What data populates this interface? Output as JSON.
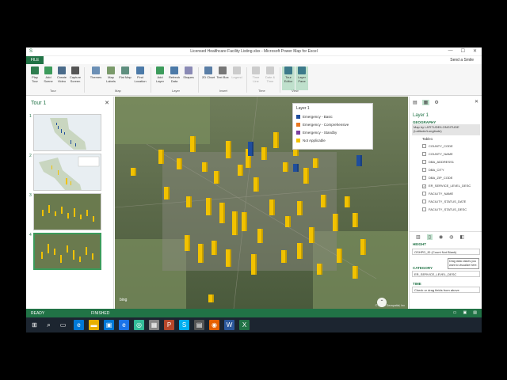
{
  "window": {
    "title": "Licensed Healthcare Facility Listing.xlsx - Microsoft Power Map for Excel",
    "file_tab": "FILE",
    "send_smile": "Send a Smile",
    "quick_access": "S",
    "min": "—",
    "max": "☐",
    "close": "✕"
  },
  "ribbon": {
    "buttons": {
      "play_tour": "Play Tour",
      "add_scene": "Add Scene",
      "create_video": "Create Video",
      "capture_screen": "Capture Screen",
      "themes": "Themes",
      "map_labels": "Map Labels",
      "flat_map": "Flat Map",
      "find_location": "Find Location",
      "add_layer": "Add Layer",
      "refresh_data": "Refresh Data",
      "shapes": "Shapes",
      "chart_2d": "2D Chart",
      "text_box": "Text Box",
      "legend": "Legend",
      "time_line": "Time Line",
      "date_time": "Date & Time",
      "tour_editor": "Tour Editor",
      "layer_pane": "Layer Pane"
    },
    "groups": {
      "tour": "Tour",
      "map": "Map",
      "layer": "Layer",
      "insert": "Insert",
      "time": "Time",
      "view": "View"
    }
  },
  "tour_pane": {
    "title": "Tour 1",
    "close": "✕",
    "scenes": [
      "1",
      "2",
      "3",
      "4"
    ]
  },
  "legend": {
    "title": "Layer 1",
    "items": [
      {
        "label": "Emergency - Basic",
        "color": "#1f4e9c"
      },
      {
        "label": "Emergency - Comprehensive",
        "color": "#e87722"
      },
      {
        "label": "Emergency - Standby",
        "color": "#7b3f9e"
      },
      {
        "label": "Not Applicable",
        "color": "#f2c200"
      }
    ]
  },
  "map": {
    "bing": "bing",
    "copyright": "© Harris Geospatial, Inc"
  },
  "field_pane": {
    "layer_name": "Layer 1",
    "close": "✕",
    "geography_label": "GEOGRAPHY",
    "geography_value": "Map by LATITUDE/LONGITUDE (Latitude/Longitude)",
    "table_name": "Table1",
    "fields": [
      {
        "name": "COUNTY_CODE",
        "checked": false
      },
      {
        "name": "COUNTY_NAME",
        "checked": false
      },
      {
        "name": "DBA_ADDRESS1",
        "checked": false
      },
      {
        "name": "DBA_CITY",
        "checked": false
      },
      {
        "name": "DBA_ZIP_CODE",
        "checked": false
      },
      {
        "name": "ER_SERVICE_LEVEL_DESC",
        "checked": true
      },
      {
        "name": "FACILITY_NAME",
        "checked": false
      },
      {
        "name": "FACILITY_STATUS_DATE",
        "checked": false
      },
      {
        "name": "FACILITY_STATUS_DESC",
        "checked": false
      }
    ],
    "height_label": "HEIGHT",
    "height_value": "OSHPD_ID (Count Not Blank)",
    "category_label": "CATEGORY",
    "category_value": "ER_SERVICE_LEVEL_DESC",
    "time_label": "TIME",
    "time_value": "Check or drag fields from above",
    "tooltip": "Drag data values you want to visualize here."
  },
  "status": {
    "ready": "READY",
    "finished": "FINISHED"
  },
  "colors": {
    "accent": "#217346",
    "bar_yellow": "#f2c200",
    "bar_blue": "#1f4e9c"
  }
}
